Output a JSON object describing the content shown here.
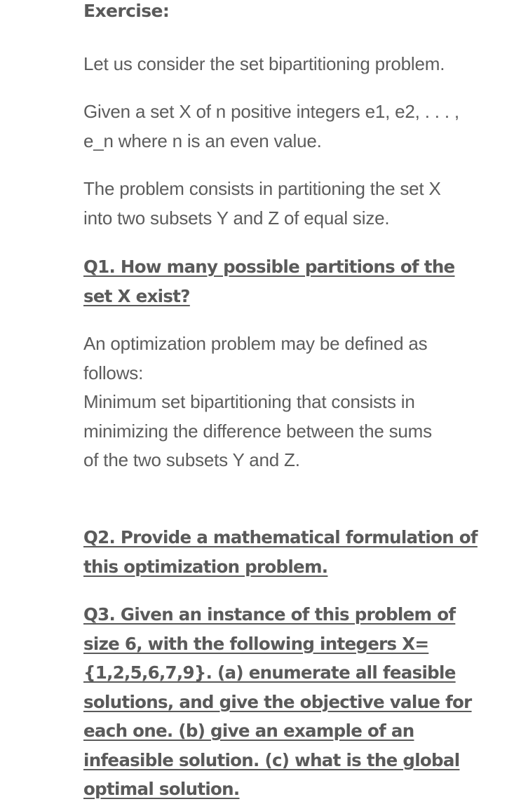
{
  "title": "Exercise:",
  "intro": "Let us consider the set bipartitioning problem.",
  "given": [
    "Given a set X of n positive integers e1, e2, . . . ,",
    "e_n where n is an even value."
  ],
  "problem": [
    "The problem consists in partitioning the set X",
    "into two subsets Y and Z of equal size."
  ],
  "q1": [
    "Q1. How many possible partitions of the",
    "set X exist?"
  ],
  "optimization": [
    "An optimization problem may be defined as",
    "follows:",
    "Minimum set bipartitioning that consists in",
    "minimizing the difference between the sums",
    "of the two subsets Y and Z."
  ],
  "q2": [
    "Q2. Provide a mathematical formulation of",
    "this optimization problem."
  ],
  "q3": [
    "Q3. Given an instance of this problem of",
    "size 6, with the following integers X=",
    "{1,2,5,6,7,9}. (a) enumerate all feasible",
    "solutions, and give the objective value for",
    "each one. (b) give an example of an",
    "infeasible solution. (c) what is the global",
    "optimal solution."
  ],
  "colors": {
    "text": "#595959",
    "background": "#ffffff"
  }
}
